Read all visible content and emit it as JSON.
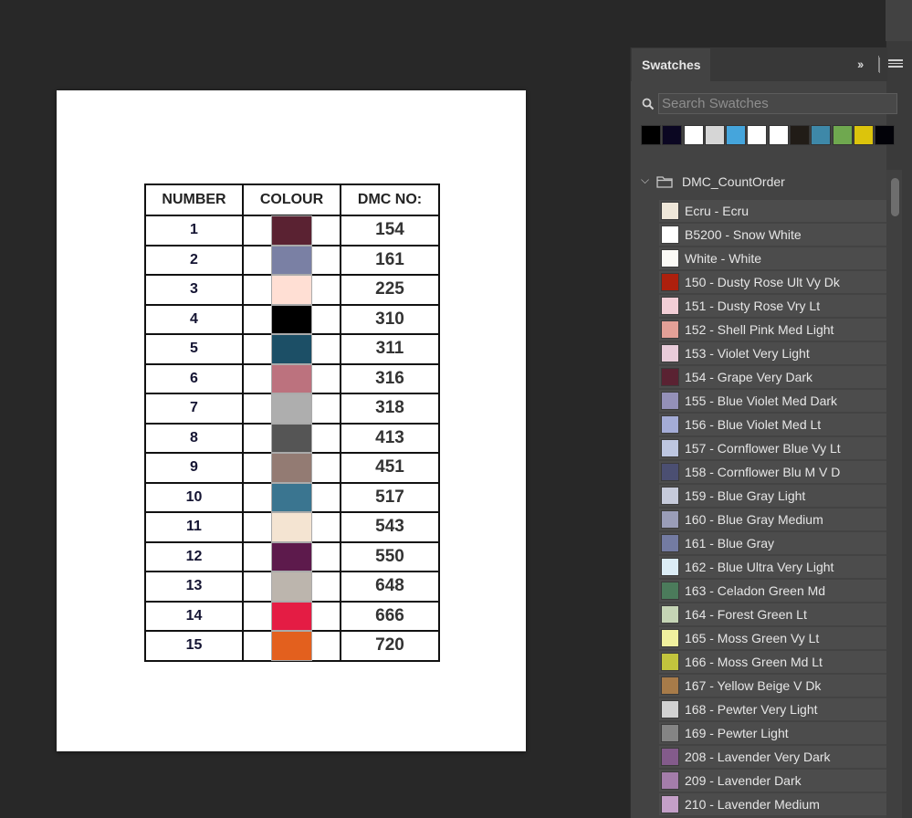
{
  "document": {
    "table": {
      "headers": [
        "NUMBER",
        "COLOUR",
        "DMC NO:"
      ],
      "rows": [
        {
          "number": "1",
          "color": "#5a2232",
          "dmc": "154"
        },
        {
          "number": "2",
          "color": "#7a80a4",
          "dmc": "161"
        },
        {
          "number": "3",
          "color": "#ffdfd4",
          "dmc": "225"
        },
        {
          "number": "4",
          "color": "#000000",
          "dmc": "310"
        },
        {
          "number": "5",
          "color": "#1c4f66",
          "dmc": "311"
        },
        {
          "number": "6",
          "color": "#bc727e",
          "dmc": "316"
        },
        {
          "number": "7",
          "color": "#aeaeae",
          "dmc": "318"
        },
        {
          "number": "8",
          "color": "#555555",
          "dmc": "413"
        },
        {
          "number": "9",
          "color": "#937b73",
          "dmc": "451"
        },
        {
          "number": "10",
          "color": "#3a7590",
          "dmc": "517"
        },
        {
          "number": "11",
          "color": "#f4e4d2",
          "dmc": "543"
        },
        {
          "number": "12",
          "color": "#5d1a4c",
          "dmc": "550"
        },
        {
          "number": "13",
          "color": "#bcb5ad",
          "dmc": "648"
        },
        {
          "number": "14",
          "color": "#e41c44",
          "dmc": "666"
        },
        {
          "number": "15",
          "color": "#e3601e",
          "dmc": "720"
        }
      ]
    }
  },
  "panel": {
    "tab_label": "Swatches",
    "collapse_icon": "double-chevron-right-icon",
    "menu_icon": "hamburger-menu-icon",
    "search": {
      "placeholder": "Search Swatches",
      "value": ""
    },
    "recent_colors": [
      "#000000",
      "#0b0722",
      "#ffffff",
      "#d6d6d6",
      "#45a5dc",
      "#ffffff",
      "#ffffff",
      "#211c17",
      "#3e88a8",
      "#6fa84f",
      "#dcc40c",
      "#020208"
    ],
    "group": {
      "name": "DMC_CountOrder",
      "expanded": true
    },
    "swatches": [
      {
        "label": "Ecru - Ecru",
        "color": "#efe7d9"
      },
      {
        "label": "B5200 - Snow White",
        "color": "#ffffff"
      },
      {
        "label": "White - White",
        "color": "#fbfaf6"
      },
      {
        "label": "150 - Dusty Rose Ult Vy Dk",
        "color": "#ad200d"
      },
      {
        "label": "151 - Dusty Rose Vry Lt",
        "color": "#f2ced6"
      },
      {
        "label": "152 - Shell Pink Med Light",
        "color": "#e3a097"
      },
      {
        "label": "153 - Violet Very Light",
        "color": "#e8cbd9"
      },
      {
        "label": "154 - Grape Very Dark",
        "color": "#5a2232"
      },
      {
        "label": "155 - Blue Violet Med Dark",
        "color": "#9490b8"
      },
      {
        "label": "156 - Blue Violet Med Lt",
        "color": "#a4acd6"
      },
      {
        "label": "157 - Cornflower Blue Vy Lt",
        "color": "#bdc6e0"
      },
      {
        "label": "158 - Cornflower Blu M V D",
        "color": "#4b4f72"
      },
      {
        "label": "159 - Blue Gray Light",
        "color": "#c6cada"
      },
      {
        "label": "160 - Blue Gray Medium",
        "color": "#9a9db8"
      },
      {
        "label": "161 - Blue Gray",
        "color": "#737ba2"
      },
      {
        "label": "162 - Blue Ultra Very Light",
        "color": "#dbecf5"
      },
      {
        "label": "163 - Celadon Green Md",
        "color": "#4b7b5b"
      },
      {
        "label": "164 - Forest Green Lt",
        "color": "#c5d4b5"
      },
      {
        "label": "165 - Moss Green Vy Lt",
        "color": "#f0f09e"
      },
      {
        "label": "166 - Moss Green Md Lt",
        "color": "#c2c43d"
      },
      {
        "label": "167 - Yellow Beige V Dk",
        "color": "#a77b49"
      },
      {
        "label": "168 - Pewter Very Light",
        "color": "#d1d1d1"
      },
      {
        "label": "169 - Pewter Light",
        "color": "#848484"
      },
      {
        "label": "208 - Lavender Very Dark",
        "color": "#835b8b"
      },
      {
        "label": "209 - Lavender Dark",
        "color": "#a47daa"
      },
      {
        "label": "210 - Lavender Medium",
        "color": "#c49fc8"
      }
    ]
  }
}
